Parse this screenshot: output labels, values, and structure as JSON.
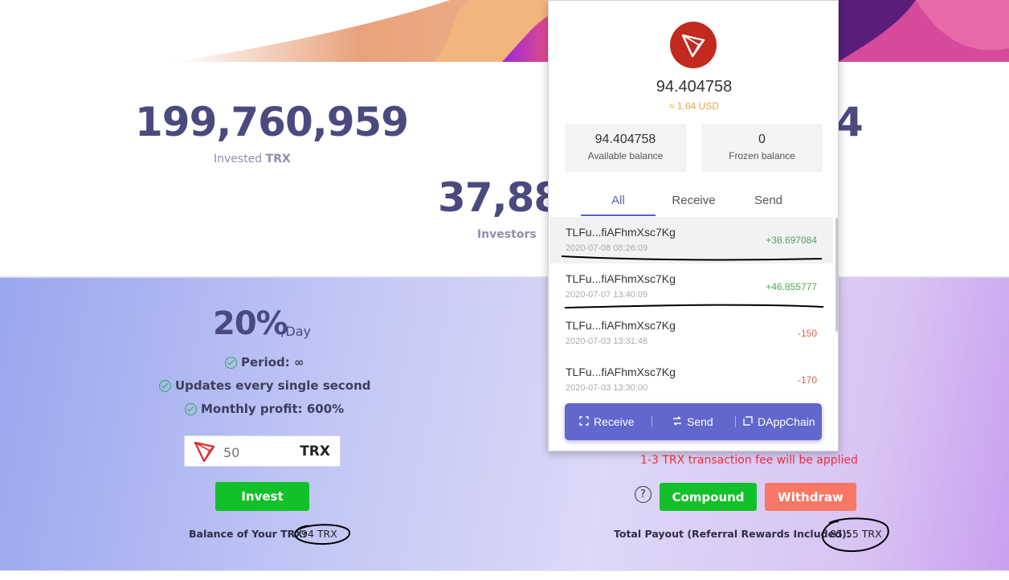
{
  "stats": {
    "invested_value": "199,760,959",
    "invested_label_prefix": "Invested",
    "invested_label_unit": "TRX",
    "investors_value": "37,88",
    "investors_label": "Investors",
    "right_value_partial": "4"
  },
  "plan": {
    "rate": "20%",
    "rate_unit": "/Day",
    "features": [
      {
        "icon": "check-circle-icon",
        "text": "Period: ∞"
      },
      {
        "icon": "check-circle-icon",
        "text": "Updates every single second"
      },
      {
        "icon": "check-circle-icon",
        "text": "Monthly profit: 600%"
      }
    ]
  },
  "invest_form": {
    "amount_placeholder": "50",
    "amount_unit": "TRX",
    "invest_label": "Invest",
    "balance_label": "Balance of Your TRX:",
    "balance_value": "94 TRX"
  },
  "withdraw_panel": {
    "fee_note": "1-3 TRX transaction fee will be applied",
    "help_glyph": "?",
    "compound_label": "Compound",
    "withdraw_label": "Withdraw",
    "payout_label": "Total Payout (Referral Rewards Included):",
    "payout_value": "85.55 TRX"
  },
  "wallet": {
    "balance": "94.404758",
    "usd": "≈ 1.64 USD",
    "available": {
      "value": "94.404758",
      "label": "Available balance"
    },
    "frozen": {
      "value": "0",
      "label": "Frozen balance"
    },
    "tabs": [
      "All",
      "Receive",
      "Send"
    ],
    "active_tab": "All",
    "transactions": [
      {
        "address": "TLFu...fiAFhmXsc7Kg",
        "time": "2020-07-08 08:26:09",
        "amount": "+38.697084"
      },
      {
        "address": "TLFu...fiAFhmXsc7Kg",
        "time": "2020-07-07 13:40:09",
        "amount": "+46.855777"
      },
      {
        "address": "TLFu...fiAFhmXsc7Kg",
        "time": "2020-07-03 13:31:48",
        "amount": "-150"
      },
      {
        "address": "TLFu...fiAFhmXsc7Kg",
        "time": "2020-07-03 13:30:00",
        "amount": "-170"
      }
    ],
    "actions": {
      "receive": "Receive",
      "send": "Send",
      "dappchain": "DAppChain"
    }
  },
  "colors": {
    "heading": "#4b4a7f",
    "green_button": "#12c02a",
    "withdraw_button": "#f87765",
    "tron_red": "#c2291f",
    "wallet_accent": "#6167cc",
    "fee_red": "#f0303c"
  }
}
